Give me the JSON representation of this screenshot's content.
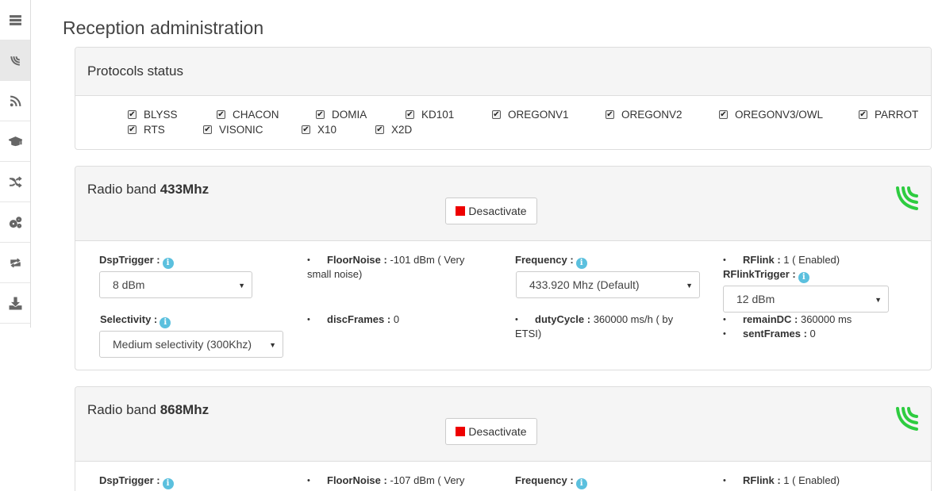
{
  "page": {
    "title": "Reception administration"
  },
  "sidebar": [
    {
      "icon": "server-icon"
    },
    {
      "icon": "wireless-icon",
      "active": true
    },
    {
      "icon": "rss-icon"
    },
    {
      "icon": "graduation-cap-icon"
    },
    {
      "icon": "random-icon"
    },
    {
      "icon": "cogs-icon"
    },
    {
      "icon": "retweet-icon"
    },
    {
      "icon": "download-icon"
    }
  ],
  "protocols": {
    "title": "Protocols status",
    "items": [
      {
        "label": "BLYSS",
        "checked": true
      },
      {
        "label": "CHACON",
        "checked": true
      },
      {
        "label": "DOMIA",
        "checked": true
      },
      {
        "label": "KD101",
        "checked": true
      },
      {
        "label": "OREGONV1",
        "checked": true
      },
      {
        "label": "OREGONV2",
        "checked": true
      },
      {
        "label": "OREGONV3/OWL",
        "checked": true
      },
      {
        "label": "PARROT",
        "checked": true
      },
      {
        "label": "RTS",
        "checked": true
      },
      {
        "label": "VISONIC",
        "checked": true
      },
      {
        "label": "X10",
        "checked": true
      },
      {
        "label": "X2D",
        "checked": true
      }
    ]
  },
  "band433": {
    "title_prefix": "Radio band ",
    "title_bold": "433Mhz",
    "button": "Desactivate",
    "status_color": "#2ecc40",
    "dsp_label": "DspTrigger :",
    "dsp_value": "8 dBm",
    "selectivity_label": "Selectivity :",
    "selectivity_value": "Medium selectivity (300Khz)",
    "floornoise_label": "FloorNoise :",
    "floornoise_value": " -101 dBm ( Very",
    "floornoise_value2": "small noise)",
    "discframes_label": "discFrames :",
    "discframes_value": " 0",
    "frequency_label": "Frequency :",
    "frequency_value": "433.920 Mhz (Default)",
    "dutycycle_label": "dutyCycle :",
    "dutycycle_value": " 360000 ms/h ( by",
    "dutycycle_value2": "ETSI)",
    "rflink_label": "RFlink :",
    "rflink_value": " 1 ( Enabled)",
    "rflinktrigger_label": "RFlinkTrigger :",
    "rflinktrigger_value": "12 dBm",
    "remaindc_label": "remainDC :",
    "remaindc_value": " 360000 ms",
    "sentframes_label": "sentFrames :",
    "sentframes_value": " 0"
  },
  "band868": {
    "title_prefix": "Radio band ",
    "title_bold": "868Mhz",
    "button": "Desactivate",
    "status_color": "#2ecc40",
    "dsp_label": "DspTrigger :",
    "floornoise_label": "FloorNoise :",
    "floornoise_value": " -107 dBm ( Very",
    "frequency_label": "Frequency :",
    "rflink_label": "RFlink :",
    "rflink_value": " 1 ( Enabled)"
  }
}
